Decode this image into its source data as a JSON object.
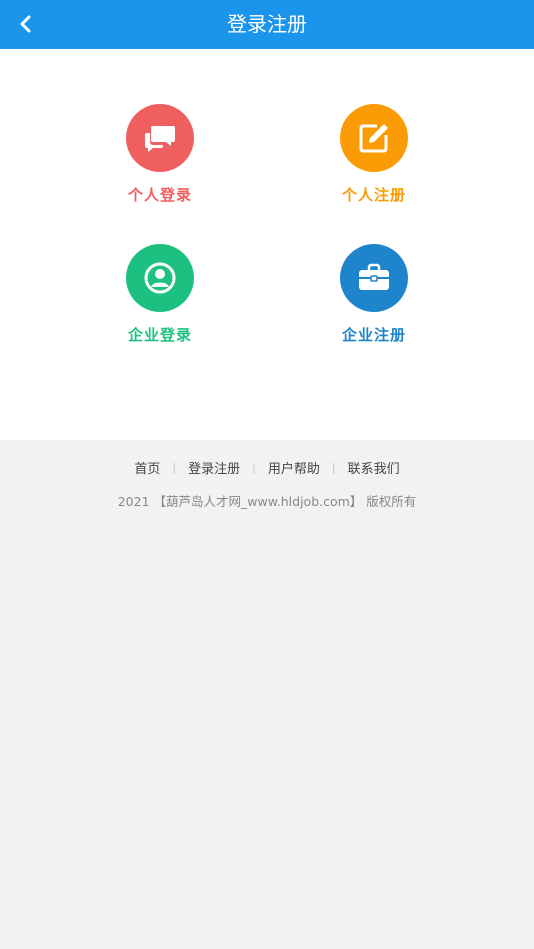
{
  "header": {
    "title": "登录注册",
    "back_icon": "chevron-left-icon"
  },
  "colors": {
    "header_bg": "#1b95ec",
    "personal_login": "#f05f5f",
    "personal_register": "#fb9c06",
    "company_login": "#1cc181",
    "company_register": "#1e85cc"
  },
  "tiles": [
    {
      "label": "个人登录",
      "icon": "chat-bubbles-icon"
    },
    {
      "label": "个人注册",
      "icon": "edit-icon"
    },
    {
      "label": "企业登录",
      "icon": "user-icon"
    },
    {
      "label": "企业注册",
      "icon": "briefcase-icon"
    }
  ],
  "footer": {
    "links": [
      "首页",
      "登录注册",
      "用户帮助",
      "联系我们"
    ],
    "separator": "|",
    "copyright": "2021 【葫芦岛人才网_www.hldjob.com】 版权所有"
  }
}
